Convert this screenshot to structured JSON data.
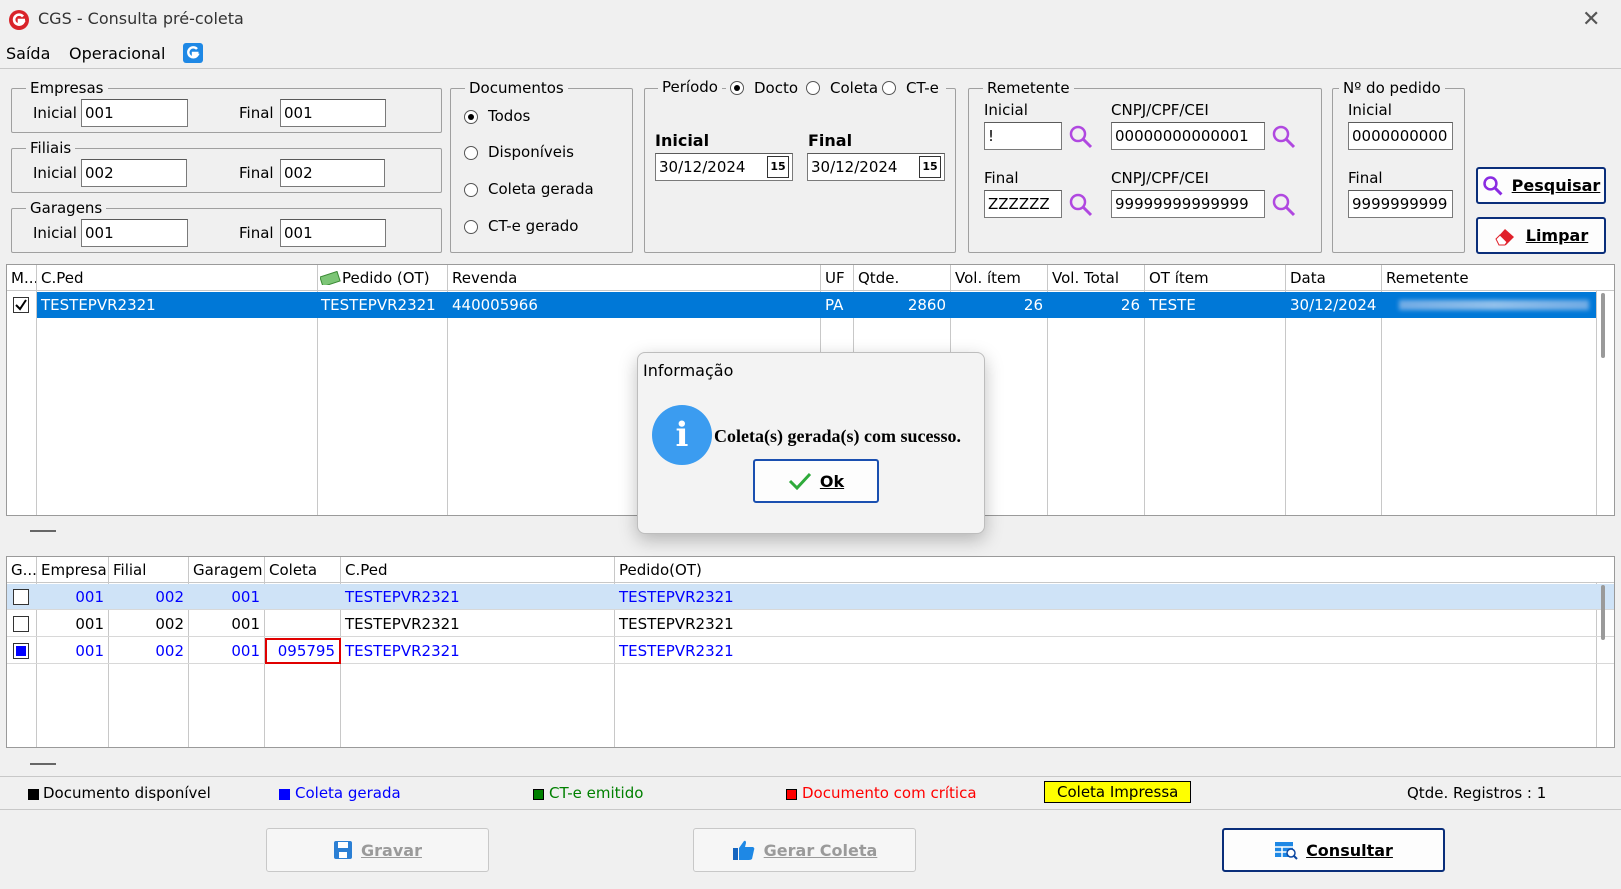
{
  "window": {
    "title": "CGS - Consulta pré-coleta",
    "close": "✕"
  },
  "menu": {
    "items": [
      "Saída",
      "Operacional"
    ]
  },
  "filters": {
    "empresas": {
      "legend": "Empresas",
      "inicial_label": "Inicial",
      "inicial": "001",
      "final_label": "Final",
      "final": "001"
    },
    "filiais": {
      "legend": "Filiais",
      "inicial_label": "Inicial",
      "inicial": "002",
      "final_label": "Final",
      "final": "002"
    },
    "garagens": {
      "legend": "Garagens",
      "inicial_label": "Inicial",
      "inicial": "001",
      "final_label": "Final",
      "final": "001"
    },
    "documentos": {
      "legend": "Documentos",
      "options": [
        "Todos",
        "Disponíveis",
        "Coleta gerada",
        "CT-e gerado"
      ],
      "selected": "Todos"
    },
    "periodo": {
      "legend": "Período",
      "options": [
        "Docto",
        "Coleta",
        "CT-e"
      ],
      "selected": "Docto",
      "inicial_label": "Inicial",
      "inicial": "30/12/2024",
      "final_label": "Final",
      "final": "30/12/2024",
      "cal_glyph": "15"
    },
    "remetente": {
      "legend": "Remetente",
      "inicial_label": "Inicial",
      "inicial": "!",
      "final_label": "Final",
      "final": "ZZZZZZ",
      "cnpj_label": "CNPJ/CPF/CEI",
      "cnpj_inicial": "00000000000001",
      "cnpj_final": "99999999999999"
    },
    "pedido": {
      "legend": "Nº do pedido",
      "inicial_label": "Inicial",
      "inicial": "0000000000",
      "final_label": "Final",
      "final": "9999999999"
    }
  },
  "buttons": {
    "pesquisar": "Pesquisar",
    "limpar": "Limpar",
    "gravar": "Gravar",
    "gerar_coleta": "Gerar Coleta",
    "consultar": "Consultar"
  },
  "grid1": {
    "headers": [
      "M...",
      "C.Ped",
      "Pedido (OT)",
      "Revenda",
      "UF",
      "Qtde.",
      "Vol. ítem",
      "Vol. Total",
      "OT ítem",
      "Data",
      "Remetente"
    ],
    "rows": [
      {
        "cped": "TESTEPVR2321",
        "pedido": "TESTEPVR2321",
        "revenda": "440005966",
        "uf": "PA",
        "qtde": "2860",
        "vol_item": "26",
        "vol_total": "26",
        "ot_item": "TESTE",
        "data": "30/12/2024",
        "remetente": ""
      }
    ]
  },
  "grid2": {
    "headers": [
      "G...",
      "Empresa",
      "Filial",
      "Garagem",
      "Coleta",
      "C.Ped",
      "Pedido(OT)"
    ],
    "rows": [
      {
        "empresa": "001",
        "filial": "002",
        "garagem": "001",
        "coleta": "",
        "cped": "TESTEPVR2321",
        "pedido": "TESTEPVR2321"
      },
      {
        "empresa": "001",
        "filial": "002",
        "garagem": "001",
        "coleta": "",
        "cped": "TESTEPVR2321",
        "pedido": "TESTEPVR2321"
      },
      {
        "empresa": "001",
        "filial": "002",
        "garagem": "001",
        "coleta": "095795",
        "cped": "TESTEPVR2321",
        "pedido": "TESTEPVR2321"
      }
    ]
  },
  "legend": {
    "disponivel": "Documento disponível",
    "coleta_gerada": "Coleta gerada",
    "cte_emitido": "CT-e emitido",
    "critica": "Documento com crítica",
    "impressa": "Coleta Impressa",
    "qtde_registros": "Qtde. Registros : 1"
  },
  "colors": {
    "selection": "#0078d7",
    "blue_text": "#0000ff",
    "green": "#008000",
    "red": "#ff0000",
    "yellow": "#ffff00",
    "highlight_row": "#cfe3f7"
  },
  "dialog": {
    "title": "Informação",
    "message": "Coleta(s) gerada(s) com sucesso.",
    "ok": "Ok",
    "icon": "i"
  }
}
